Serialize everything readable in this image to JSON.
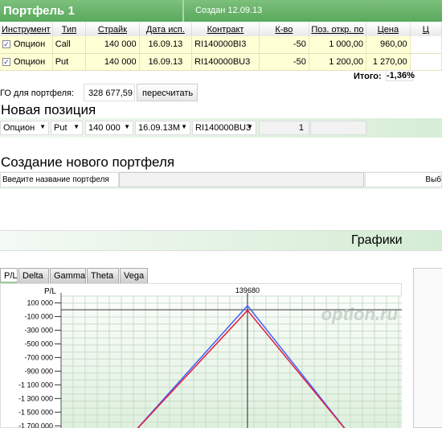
{
  "portfolio": {
    "title": "Портфель 1",
    "created": "Создан 12.09.13"
  },
  "table": {
    "headers": [
      "Инструмент",
      "Тип",
      "Страйк",
      "Дата исп.",
      "Контракт",
      "К-во",
      "Поз. откр. по",
      "Цена",
      "Ц"
    ],
    "rows": [
      {
        "checked": true,
        "instrument": "Опцион",
        "type": "Call",
        "strike": "140 000",
        "date": "16.09.13",
        "contract": "RI140000BI3",
        "qty": "-50",
        "open": "1 000,00",
        "price": "960,00"
      },
      {
        "checked": true,
        "instrument": "Опцион",
        "type": "Put",
        "strike": "140 000",
        "date": "16.09.13",
        "contract": "RI140000BU3",
        "qty": "-50",
        "open": "1 200,00",
        "price": "1 270,00"
      }
    ],
    "total_label": "Итого:",
    "total_value": "-1,36%"
  },
  "go": {
    "label": "ГО для портфеля:",
    "value": "328 677,59",
    "button": "пересчитать"
  },
  "new_position": {
    "title": "Новая позиция",
    "instrument": "Опцион",
    "type": "Put",
    "strike": "140 000",
    "date": "16.09.13M",
    "contract": "RI140000BU3",
    "qty": "1",
    "extra": ""
  },
  "new_portfolio": {
    "title": "Создание нового портфеля",
    "label": "Введите название портфеля",
    "value": "",
    "button": "Выб"
  },
  "charts": {
    "title": "Графики",
    "tabs": [
      "P/L",
      "Delta",
      "Gamma",
      "Theta",
      "Vega"
    ],
    "active_tab": "P/L",
    "watermark": "option.ru"
  },
  "chart_data": {
    "type": "line",
    "ylabel": "P/L",
    "marker_label": "139680",
    "marker_x": 139680,
    "yticks": [
      "100 000",
      "-100 000",
      "-300 000",
      "-500 000",
      "-700 000",
      "-900 000",
      "-1 100 000",
      "-1 300 000",
      "-1 500 000",
      "-1 700 000"
    ],
    "ytick_values": [
      100000,
      -100000,
      -300000,
      -500000,
      -700000,
      -900000,
      -1100000,
      -1300000,
      -1500000,
      -1700000
    ],
    "xlim": [
      124000,
      153000
    ],
    "ylim": [
      -1850000,
      200000
    ],
    "grid": true,
    "series": [
      {
        "color": "#4060ff",
        "x": [
          129840,
          139680,
          148380
        ],
        "y": [
          -1850000,
          60000,
          -1850000
        ]
      },
      {
        "color": "#e02040",
        "x": [
          129840,
          139680,
          148380
        ],
        "y": [
          -1850000,
          -10000,
          -1850000
        ]
      }
    ]
  }
}
